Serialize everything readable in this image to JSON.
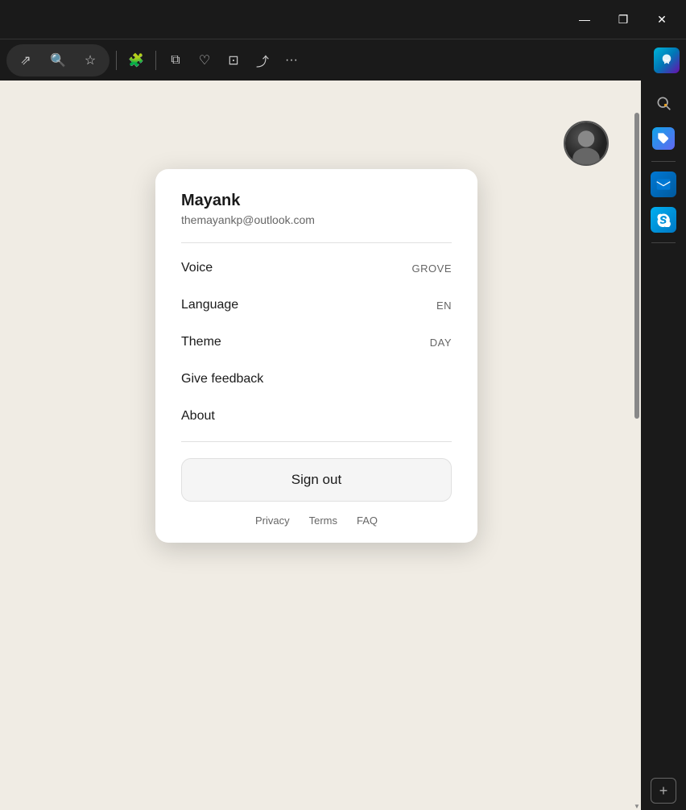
{
  "titlebar": {
    "minimize_label": "—",
    "restore_label": "❐",
    "close_label": "✕"
  },
  "toolbar": {
    "open_label": "⇗",
    "zoom_out_label": "🔍",
    "bookmark_label": "☆",
    "extensions_label": "🧩",
    "split_view_label": "⧉",
    "health_label": "♡",
    "screenshot_label": "⊡",
    "share_label": "⤴",
    "more_label": "···"
  },
  "sidebar": {
    "search_label": "🔍",
    "tag_label": "🏷",
    "outlook_label": "O",
    "skype_label": "S",
    "add_label": "+",
    "copilot_label": "✦"
  },
  "profile": {
    "name": "Mayank",
    "email": "themayankp@outlook.com"
  },
  "menu": {
    "voice_label": "Voice",
    "voice_value": "GROVE",
    "language_label": "Language",
    "language_value": "EN",
    "theme_label": "Theme",
    "theme_value": "DAY",
    "feedback_label": "Give feedback",
    "about_label": "About",
    "signout_label": "Sign out"
  },
  "footer": {
    "privacy_label": "Privacy",
    "terms_label": "Terms",
    "faq_label": "FAQ"
  }
}
